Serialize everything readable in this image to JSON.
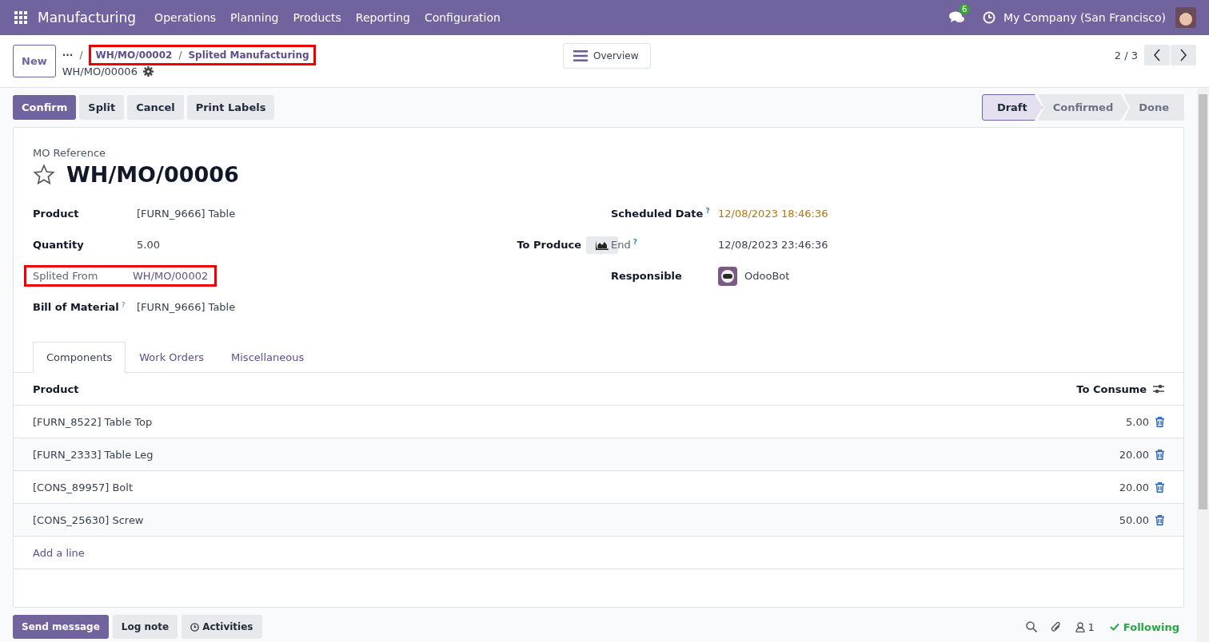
{
  "navbar": {
    "app": "Manufacturing",
    "menus": [
      "Operations",
      "Planning",
      "Products",
      "Reporting",
      "Configuration"
    ],
    "message_count": "6",
    "company": "My Company (San Francisco)"
  },
  "control_panel": {
    "new_button": "New",
    "ellipsis": "···",
    "separators": [
      "/",
      "/"
    ],
    "breadcrumbs": [
      "WH/MO/00002",
      "Splited Manufacturing"
    ],
    "breadcrumbs_highlighted": true,
    "record": "WH/MO/00006",
    "overview": "Overview",
    "pager": "2 / 3"
  },
  "actions": [
    {
      "label": "Confirm",
      "primary": true
    },
    {
      "label": "Split",
      "primary": false
    },
    {
      "label": "Cancel",
      "primary": false
    },
    {
      "label": "Print Labels",
      "primary": false
    }
  ],
  "stages": [
    {
      "label": "Draft",
      "selected": true
    },
    {
      "label": "Confirmed",
      "selected": false
    },
    {
      "label": "Done",
      "selected": false
    }
  ],
  "form": {
    "ref_label": "MO Reference",
    "title": "WH/MO/00006",
    "starred": false,
    "left_fields": [
      {
        "label": "Product",
        "value": "[FURN_9666] Table",
        "kind": "text",
        "muted_label": false,
        "highlighted": false
      },
      {
        "label": "Quantity",
        "value": "5.00",
        "kind": "text",
        "muted_label": false,
        "highlighted": false
      },
      {
        "label": "Splited From",
        "value": "WH/MO/00002",
        "kind": "link",
        "muted_label": true,
        "highlighted": true
      },
      {
        "label": "Bill of Material",
        "value": "[FURN_9666] Table",
        "kind": "text",
        "help": "?",
        "muted_label": false,
        "highlighted": false
      }
    ],
    "to_produce": "To Produce",
    "right_fields": [
      {
        "label": "Scheduled Date",
        "value": "12/08/2023 18:46:36",
        "kind": "warning",
        "help": "?",
        "muted_label": false
      },
      {
        "label": "End",
        "value": "12/08/2023 23:46:36",
        "kind": "text",
        "help": "?",
        "muted_label": true
      },
      {
        "label": "Responsible",
        "value": "OdooBot",
        "kind": "user",
        "muted_label": false
      }
    ]
  },
  "tabs": [
    {
      "label": "Components",
      "selected": true
    },
    {
      "label": "Work Orders",
      "selected": false
    },
    {
      "label": "Miscellaneous",
      "selected": false
    }
  ],
  "table": {
    "columns": [
      "Product",
      "To Consume"
    ],
    "rows": [
      {
        "product": "[FURN_8522] Table Top",
        "qty": "5.00"
      },
      {
        "product": "[FURN_2333] Table Leg",
        "qty": "20.00"
      },
      {
        "product": "[CONS_89957] Bolt",
        "qty": "20.00"
      },
      {
        "product": "[CONS_25630] Screw",
        "qty": "50.00"
      }
    ],
    "add_line": "Add a line"
  },
  "chatter": {
    "send": "Send message",
    "log": "Log note",
    "activities": "Activities",
    "followers": "1",
    "following": "Following"
  }
}
